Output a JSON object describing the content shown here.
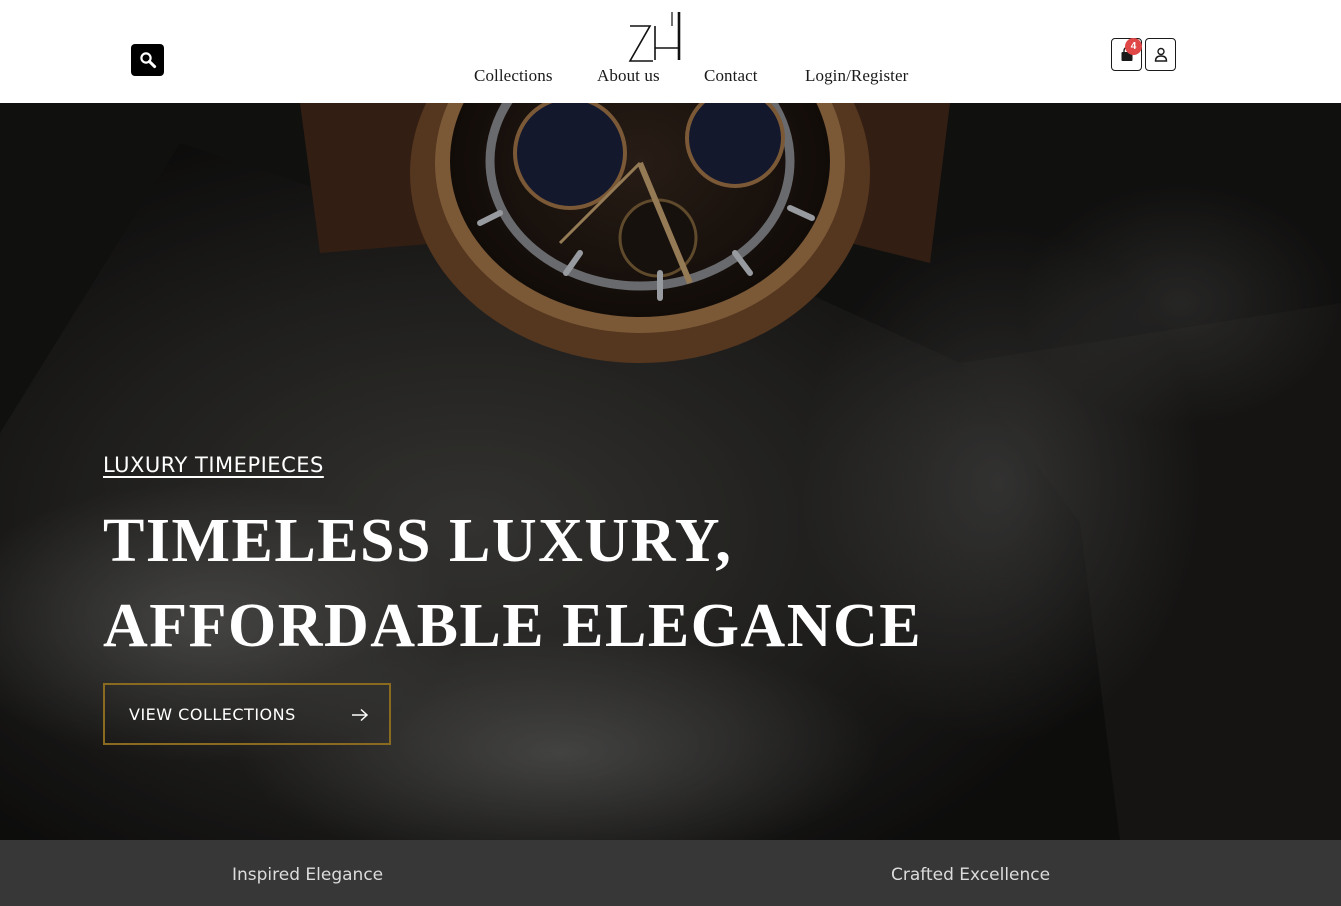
{
  "header": {
    "logo_icon": "zh-monogram-logo",
    "search_icon": "search-icon",
    "nav": [
      {
        "label": "Collections"
      },
      {
        "label": "About us"
      },
      {
        "label": "Contact"
      },
      {
        "label": "Login/Register"
      }
    ],
    "cart": {
      "icon": "shopping-bag-icon",
      "count": "4"
    },
    "account_icon": "user-icon"
  },
  "hero": {
    "eyebrow": "LUXURY TIMEPIECES",
    "headline_line1": "TIMELESS LUXURY,",
    "headline_line2": "AFFORDABLE ELEGANCE",
    "cta_label": "VIEW COLLECTIONS",
    "cta_icon": "arrow-right-icon",
    "background_image": "wristwatch-on-rock-with-smoke"
  },
  "features": [
    {
      "title": "Inspired Elegance"
    },
    {
      "title": "Crafted Excellence"
    }
  ],
  "colors": {
    "header_bg": "#ffffff",
    "hero_overlay": "#1c1b1a",
    "cta_border": "#8a6a1e",
    "badge": "#e04848",
    "features_bg": "#373737",
    "text_light": "#ffffff"
  }
}
